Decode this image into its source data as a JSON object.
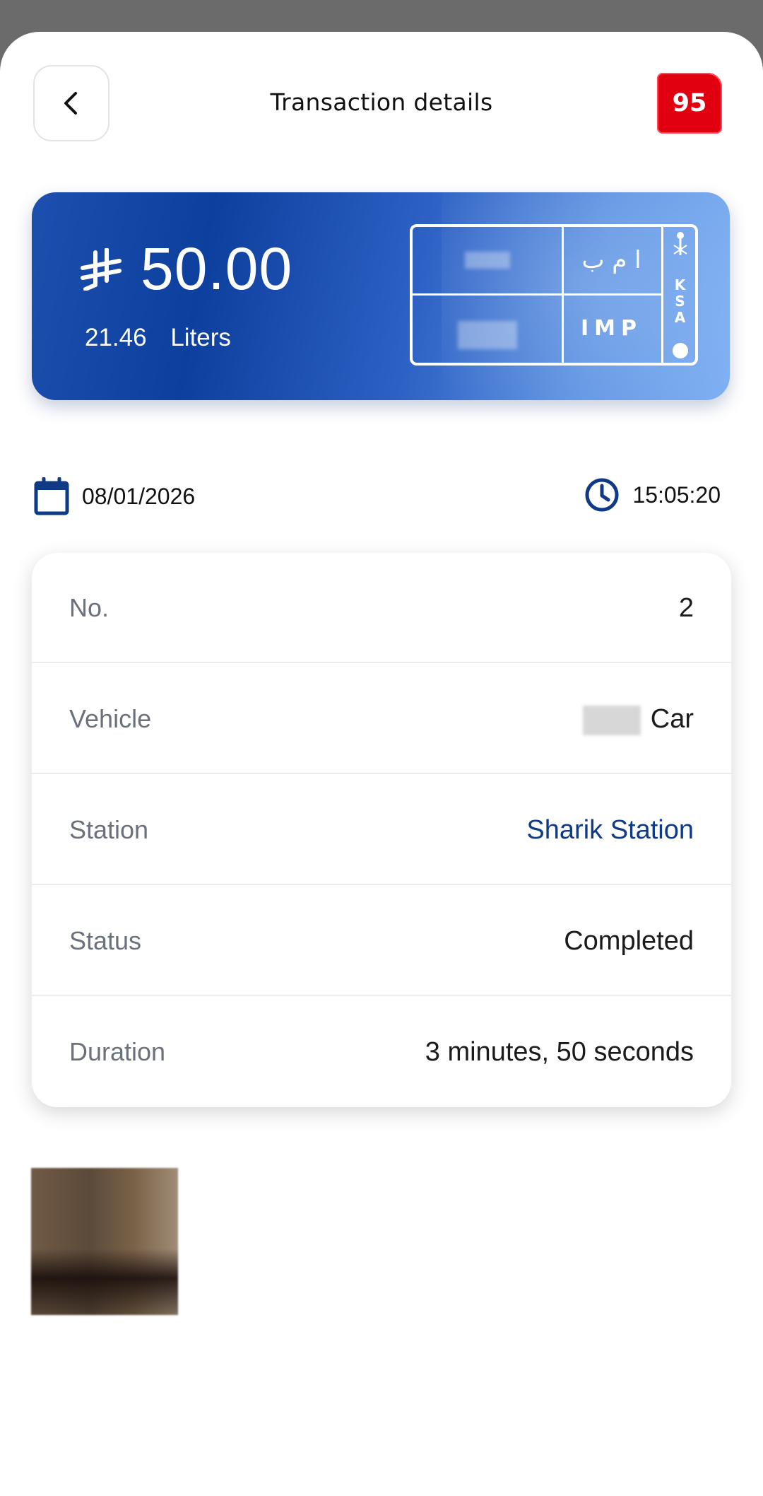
{
  "header": {
    "title": "Transaction details",
    "fuel_grade": "95",
    "back_icon": "chevron-left-icon"
  },
  "amount_card": {
    "currency_icon": "saudi-riyal-icon",
    "amount": "50.00",
    "liters_value": "21.46",
    "liters_unit": "Liters",
    "plate": {
      "arabic_letters": "ا م ب",
      "latin_letters": "IMP",
      "country_letters": [
        "K",
        "S",
        "A"
      ]
    }
  },
  "meta": {
    "date": "08/01/2026",
    "time": "15:05:20",
    "date_icon": "calendar-icon",
    "time_icon": "clock-icon"
  },
  "details": [
    {
      "label": "No.",
      "value": "2"
    },
    {
      "label": "Vehicle",
      "value": "Car"
    },
    {
      "label": "Station",
      "value": "Sharik Station"
    },
    {
      "label": "Status",
      "value": "Completed"
    },
    {
      "label": "Duration",
      "value": "3 minutes, 50 seconds"
    }
  ],
  "colors": {
    "accent_blue": "#0f3a85",
    "badge_red": "#e1000f",
    "card_gradient_start": "#0d3f9e",
    "card_gradient_end": "#7fb0f3"
  }
}
